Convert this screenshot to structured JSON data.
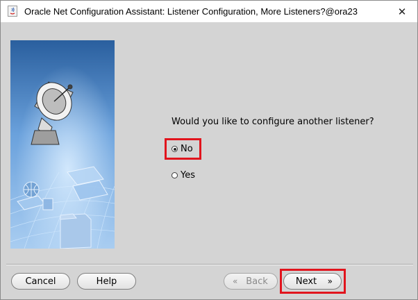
{
  "window": {
    "title": "Oracle Net Configuration Assistant: Listener Configuration, More Listeners?@ora23",
    "close_glyph": "✕"
  },
  "main": {
    "question": "Would you like to configure another listener?",
    "options": [
      {
        "label": "No",
        "checked": true
      },
      {
        "label": "Yes",
        "checked": false
      }
    ]
  },
  "buttons": {
    "cancel": "Cancel",
    "help": "Help",
    "back": "Back",
    "next": "Next",
    "back_enabled": false
  },
  "icons": {
    "back_arrow": "chevron-left-double-icon",
    "next_arrow": "chevron-right-double-icon"
  },
  "colors": {
    "highlight": "#e1141d",
    "panel_background": "#d4d4d4",
    "image_blue": "#4f8fd6"
  }
}
